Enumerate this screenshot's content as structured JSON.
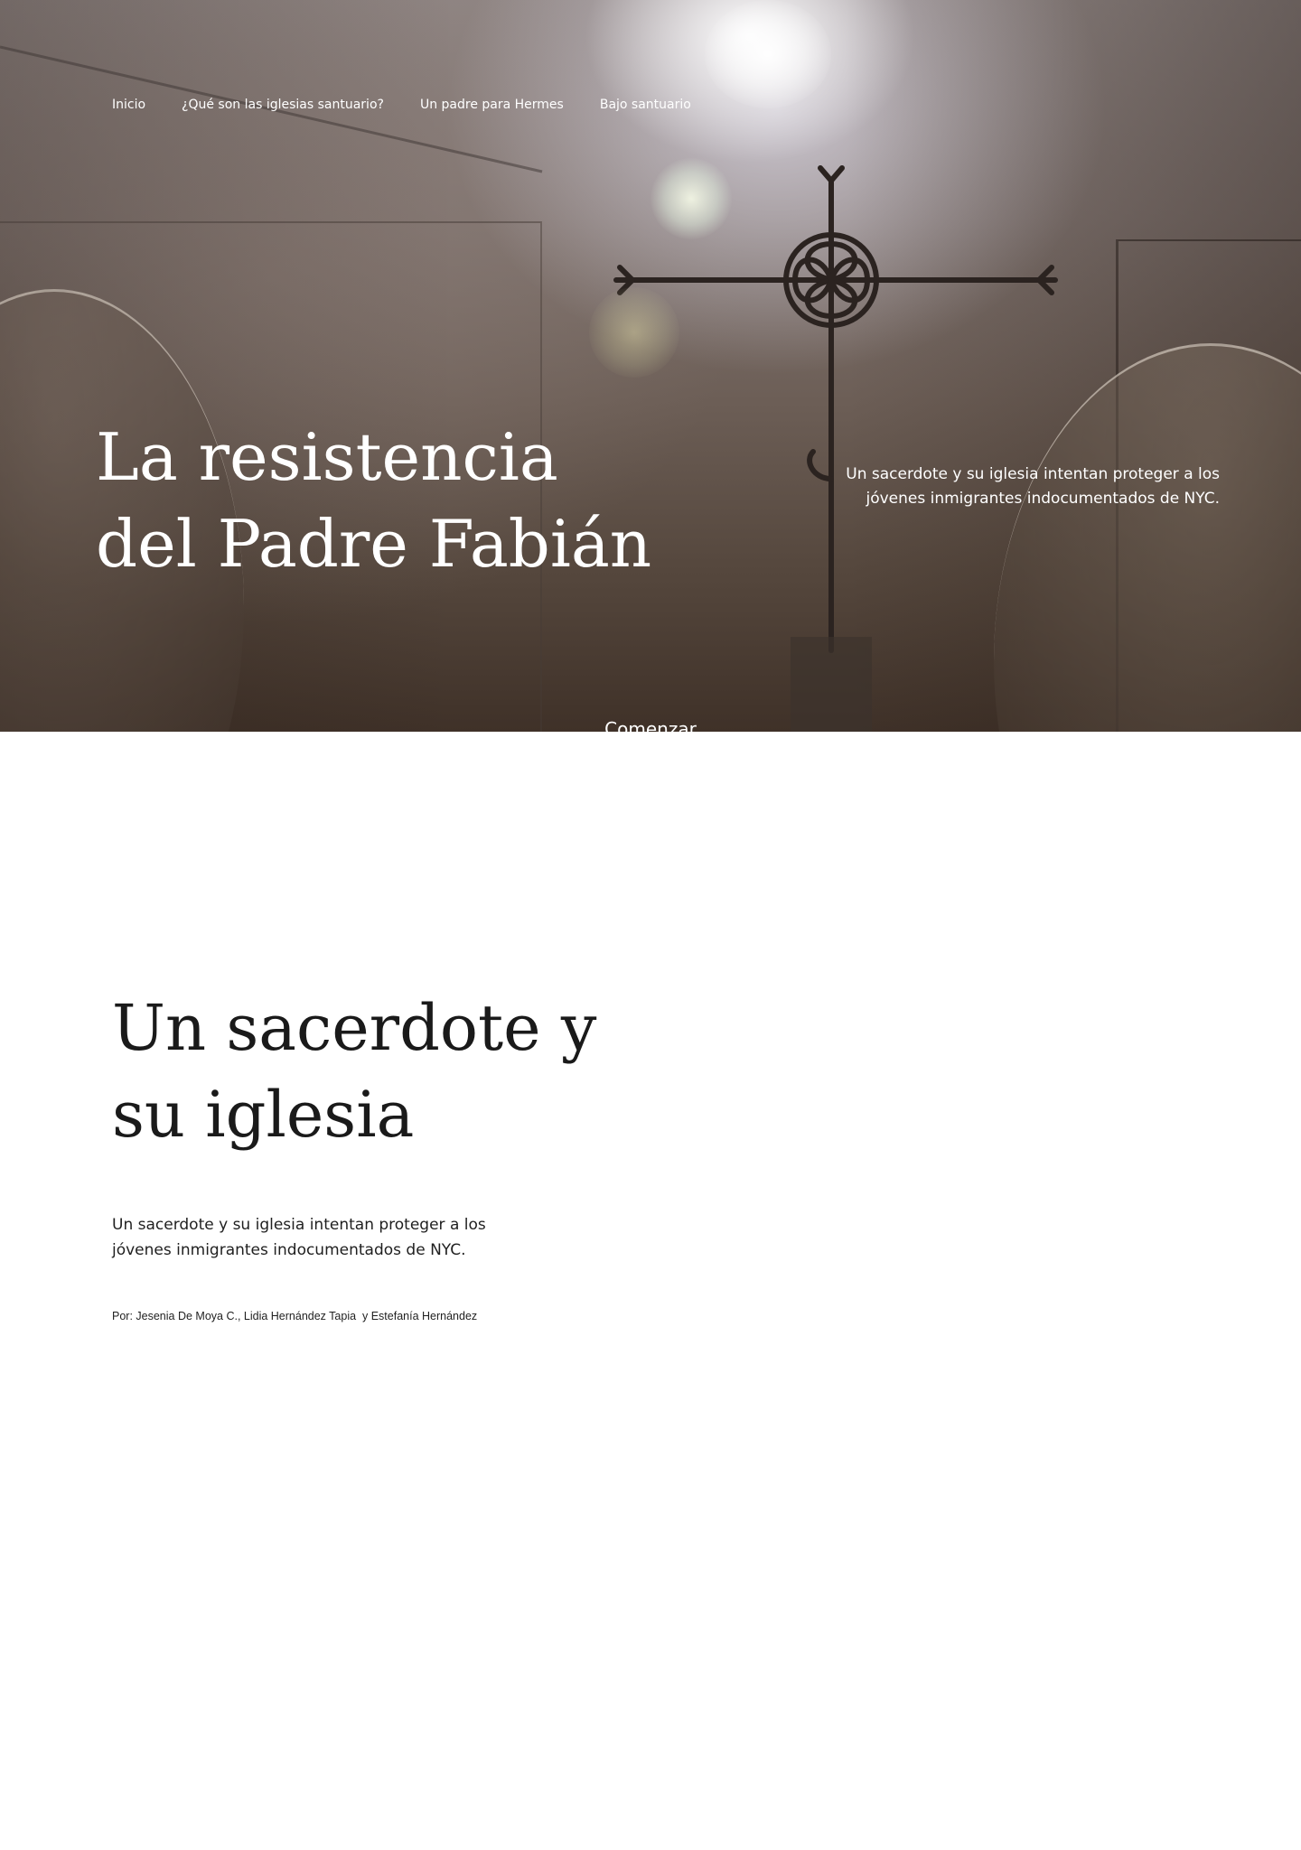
{
  "nav": {
    "items": [
      {
        "label": "Inicio"
      },
      {
        "label": "¿Qué son las iglesias santuario?"
      },
      {
        "label": "Un padre para Hermes"
      },
      {
        "label": "Bajo santuario"
      }
    ]
  },
  "hero": {
    "title_line1": "La resistencia",
    "title_line2": "del Padre Fabián",
    "subtitle_line1": "Un sacerdote y su iglesia intentan proteger a los",
    "subtitle_line2": "jóvenes inmigrantes indocumentados de NYC.",
    "begin_label": "Comenzar",
    "background": "church interior with iron cross and lens flare"
  },
  "intro": {
    "title_line1": "Un sacerdote y",
    "title_line2": "su iglesia",
    "deck": "Un sacerdote y su iglesia intentan proteger a los jóvenes inmigrantes indocumentados de NYC.",
    "byline": "Por: Jesenia De Moya C., Lidia Hernández Tapia  y Estefanía Hernández"
  },
  "colors": {
    "hero_text": "#ffffff",
    "body_text": "#1a1a1a",
    "page_background": "#ffffff"
  }
}
